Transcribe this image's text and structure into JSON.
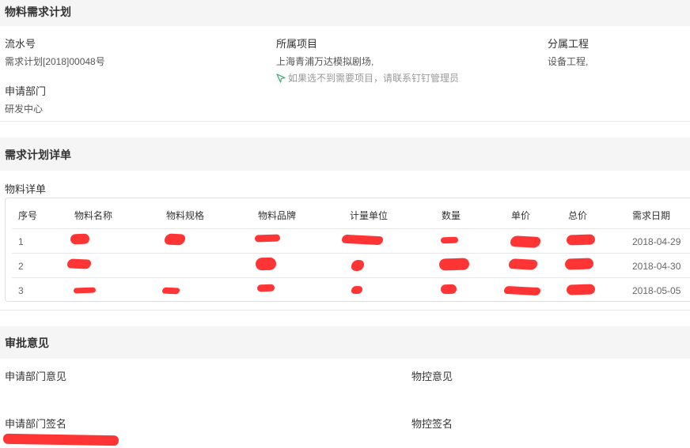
{
  "sections": {
    "plan": "物料需求计划",
    "detail": "需求计划详单",
    "approval": "审批意见"
  },
  "plan": {
    "serial_label": "流水号",
    "serial_value": "需求计划[2018]00048号",
    "project_label": "所属项目",
    "project_value": "上海青浦万达模拟剧场,",
    "project_hint": "如果选不到需要项目，请联系钉钉管理员",
    "sub_label": "分属工程",
    "sub_value": "设备工程,",
    "dept_label": "申请部门",
    "dept_value": "研发中心"
  },
  "detail": {
    "list_title": "物料详单",
    "columns": [
      "序号",
      "物料名称",
      "物料规格",
      "物料品牌",
      "计量单位",
      "数量",
      "单价",
      "总价",
      "需求日期"
    ],
    "rows": [
      {
        "no": "1",
        "date": "2018-04-29"
      },
      {
        "no": "2",
        "date": "2018-04-30"
      },
      {
        "no": "3",
        "date": "2018-05-05"
      }
    ]
  },
  "approval": {
    "dept_opinion_label": "申请部门意见",
    "control_opinion_label": "物控意见",
    "dept_sign_label": "申请部门签名",
    "control_sign_label": "物控签名"
  },
  "colors": {
    "header_bg": "#f5f5f5",
    "hint_icon": "#4caf7d",
    "redaction": "#ff2a2a"
  }
}
